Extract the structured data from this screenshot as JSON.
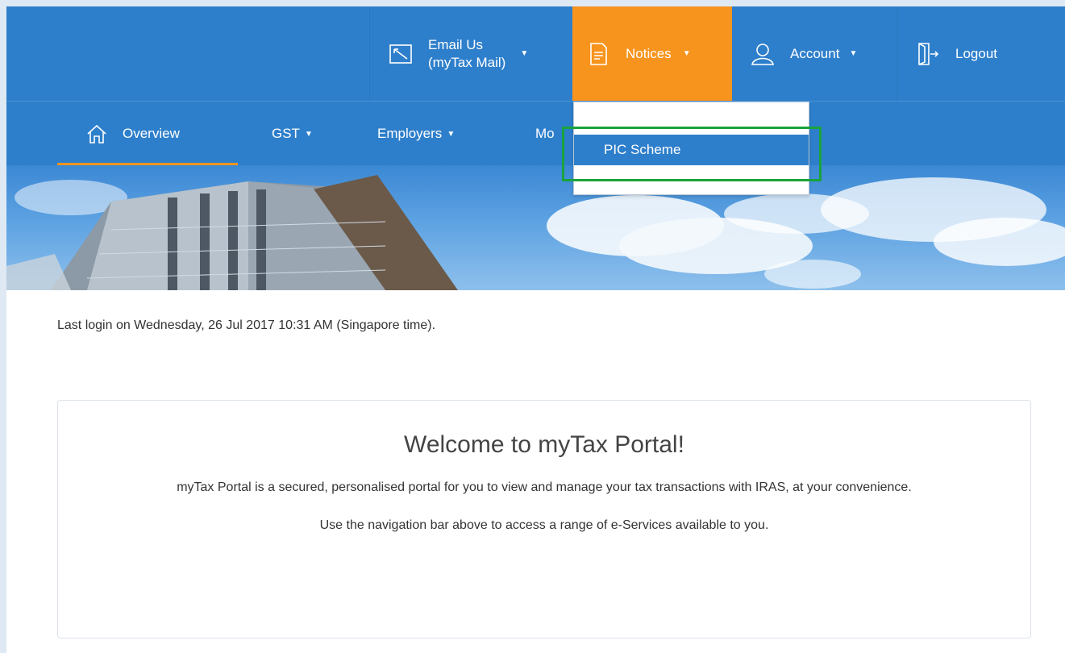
{
  "topbar": {
    "email": {
      "line1": "Email Us",
      "line2": "(myTax Mail)",
      "icon": "mail-icon"
    },
    "notices": {
      "label": "Notices",
      "icon": "document-icon"
    },
    "account": {
      "label": "Account",
      "icon": "user-icon"
    },
    "logout": {
      "label": "Logout",
      "icon": "logout-icon"
    },
    "caret": "▼"
  },
  "nav": {
    "overview": {
      "label": "Overview",
      "icon": "home-icon"
    },
    "gst": "GST",
    "employers": "Employers",
    "more": "Mo",
    "caret": "▼"
  },
  "dropdown": {
    "items": [
      "PIC Scheme"
    ]
  },
  "content": {
    "last_login": "Last login on Wednesday, 26 Jul 2017 10:31 AM (Singapore time).",
    "welcome_title": "Welcome to myTax Portal!",
    "welcome_desc": "myTax Portal is a secured, personalised portal for you to view and manage your tax transactions with IRAS, at your convenience.",
    "welcome_hint": "Use the navigation bar above to access a range of e-Services available to you."
  },
  "colors": {
    "primary": "#2e7fcb",
    "accent": "#f7941d",
    "highlight": "#1aa33c"
  }
}
